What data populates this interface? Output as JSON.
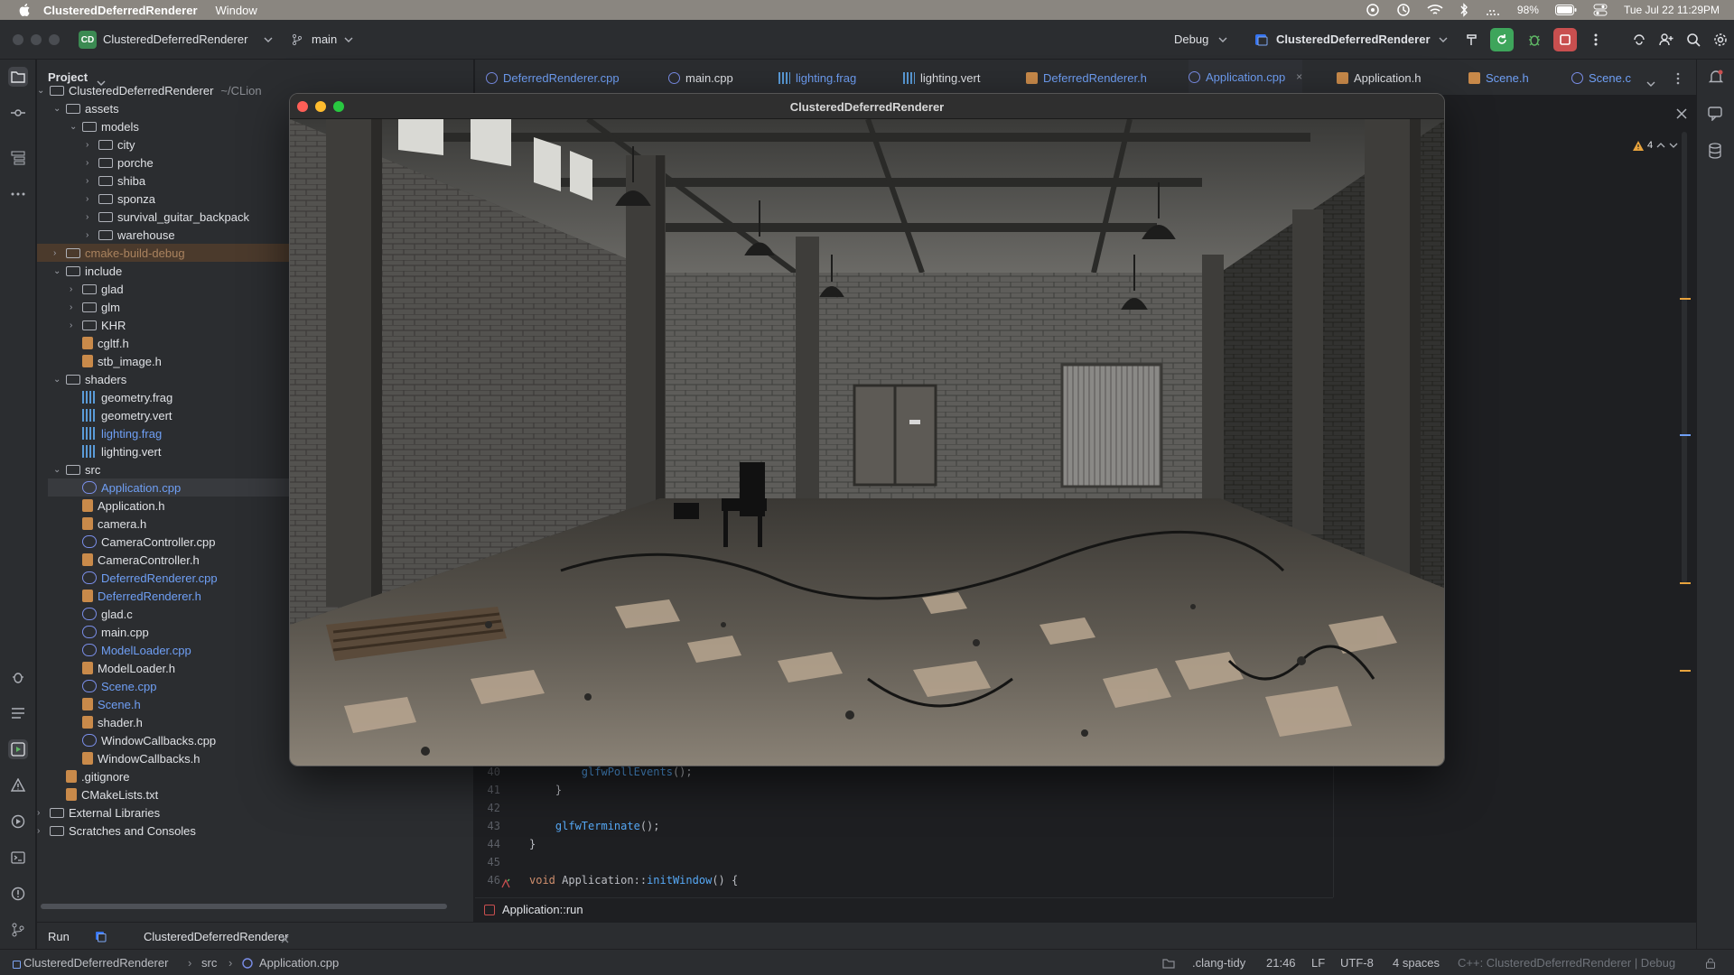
{
  "menubar": {
    "app_name": "ClusteredDeferredRenderer",
    "menus": [
      "Window"
    ],
    "battery": "98%",
    "datetime": "Tue Jul 22  11:29PM"
  },
  "toolbar": {
    "project_badge": "CD",
    "project_name": "ClusteredDeferredRenderer",
    "branch": "main",
    "build_config": "Debug",
    "run_config": "ClusteredDeferredRenderer"
  },
  "project_panel": {
    "title": "Project",
    "root_name": "ClusteredDeferredRenderer",
    "root_path": "~/CLion",
    "items": [
      {
        "label": "assets",
        "kind": "folder"
      },
      {
        "label": "models",
        "kind": "folder"
      },
      {
        "label": "city",
        "kind": "folder"
      },
      {
        "label": "porche",
        "kind": "folder"
      },
      {
        "label": "shiba",
        "kind": "folder"
      },
      {
        "label": "sponza",
        "kind": "folder"
      },
      {
        "label": "survival_guitar_backpack",
        "kind": "folder"
      },
      {
        "label": "warehouse",
        "kind": "folder"
      },
      {
        "label": "cmake-build-debug",
        "kind": "folder"
      },
      {
        "label": "include",
        "kind": "folder"
      },
      {
        "label": "glad",
        "kind": "folder"
      },
      {
        "label": "glm",
        "kind": "folder"
      },
      {
        "label": "KHR",
        "kind": "folder"
      },
      {
        "label": "cgltf.h",
        "kind": "h"
      },
      {
        "label": "stb_image.h",
        "kind": "h"
      },
      {
        "label": "shaders",
        "kind": "folder"
      },
      {
        "label": "geometry.frag",
        "kind": "glsl"
      },
      {
        "label": "geometry.vert",
        "kind": "glsl"
      },
      {
        "label": "lighting.frag",
        "kind": "glsl"
      },
      {
        "label": "lighting.vert",
        "kind": "glsl"
      },
      {
        "label": "src",
        "kind": "folder"
      },
      {
        "label": "Application.cpp",
        "kind": "cpp"
      },
      {
        "label": "Application.h",
        "kind": "h"
      },
      {
        "label": "camera.h",
        "kind": "h"
      },
      {
        "label": "CameraController.cpp",
        "kind": "cpp"
      },
      {
        "label": "CameraController.h",
        "kind": "h"
      },
      {
        "label": "DeferredRenderer.cpp",
        "kind": "cpp"
      },
      {
        "label": "DeferredRenderer.h",
        "kind": "h"
      },
      {
        "label": "glad.c",
        "kind": "cpp"
      },
      {
        "label": "main.cpp",
        "kind": "cpp"
      },
      {
        "label": "ModelLoader.cpp",
        "kind": "cpp"
      },
      {
        "label": "ModelLoader.h",
        "kind": "h"
      },
      {
        "label": "Scene.cpp",
        "kind": "cpp"
      },
      {
        "label": "Scene.h",
        "kind": "h"
      },
      {
        "label": "shader.h",
        "kind": "h"
      },
      {
        "label": "WindowCallbacks.cpp",
        "kind": "cpp"
      },
      {
        "label": "WindowCallbacks.h",
        "kind": "h"
      },
      {
        "label": ".gitignore",
        "kind": "file"
      },
      {
        "label": "CMakeLists.txt",
        "kind": "file"
      },
      {
        "label": "External Libraries",
        "kind": "lib"
      },
      {
        "label": "Scratches and Consoles",
        "kind": "lib"
      }
    ]
  },
  "tabs": [
    {
      "label": "DeferredRenderer.cpp",
      "kind": "cpp"
    },
    {
      "label": "main.cpp",
      "kind": "cpp"
    },
    {
      "label": "lighting.frag",
      "kind": "glsl"
    },
    {
      "label": "lighting.vert",
      "kind": "glsl"
    },
    {
      "label": "DeferredRenderer.h",
      "kind": "h"
    },
    {
      "label": "Application.cpp",
      "kind": "cpp"
    },
    {
      "label": "Application.h",
      "kind": "h"
    },
    {
      "label": "Scene.h",
      "kind": "h"
    },
    {
      "label": "Scene.c",
      "kind": "cpp"
    }
  ],
  "editor": {
    "warnings_count": "4",
    "code_lines": [
      {
        "num": "40",
        "text": "        glfwPollEvents();"
      },
      {
        "num": "41",
        "text": "    }"
      },
      {
        "num": "42",
        "text": ""
      },
      {
        "num": "43",
        "text": "    glfwTerminate();"
      },
      {
        "num": "44",
        "text": "}"
      },
      {
        "num": "45",
        "text": ""
      },
      {
        "num": "46",
        "text": "void Application::initWindow() {"
      }
    ],
    "breadcrumb": "Application::run"
  },
  "render_window": {
    "title": "ClusteredDeferredRenderer"
  },
  "runbar": {
    "run_label": "Run",
    "run_tab": "ClusteredDeferredRenderer"
  },
  "statusbar": {
    "path": [
      "ClusteredDeferredRenderer",
      "src",
      "Application.cpp"
    ],
    "linter": ".clang-tidy",
    "position": "21:46",
    "line_sep": "LF",
    "encoding": "UTF-8",
    "indent": "4 spaces",
    "context": "C++: ClusteredDeferredRenderer | Debug"
  },
  "colors": {
    "accent": "#3574f0",
    "run_green": "#3ea55b",
    "stop_red": "#c94f4f",
    "modified_blue": "#6f9ff5"
  }
}
